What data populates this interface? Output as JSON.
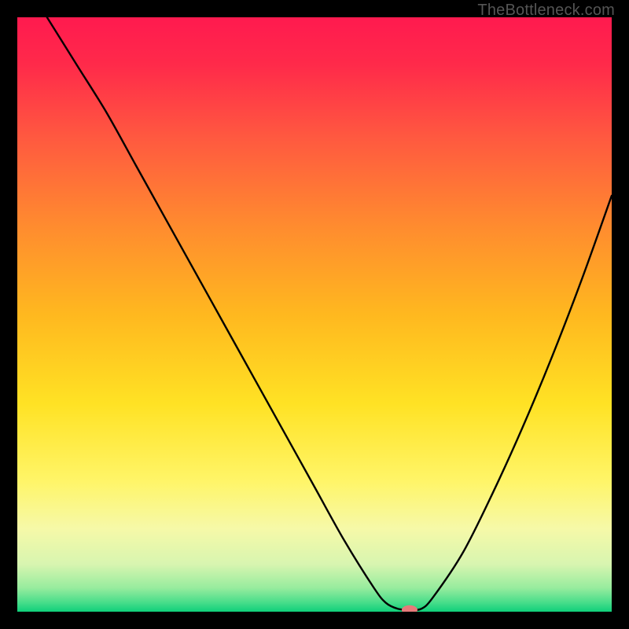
{
  "watermark": "TheBottleneck.com",
  "chart_data": {
    "type": "line",
    "title": "",
    "xlabel": "",
    "ylabel": "",
    "xlim": [
      0,
      100
    ],
    "ylim": [
      0,
      100
    ],
    "x": [
      5,
      10,
      15,
      20,
      25,
      30,
      35,
      40,
      45,
      50,
      55,
      60,
      62,
      64,
      66,
      68,
      70,
      75,
      80,
      85,
      90,
      95,
      100
    ],
    "values": [
      100,
      92,
      84,
      75,
      66,
      57,
      48,
      39,
      30,
      21,
      12,
      4,
      1.5,
      0.5,
      0.3,
      0.5,
      2.5,
      10,
      20,
      31,
      43,
      56,
      70
    ],
    "marker": {
      "x": 66,
      "y": 0.3
    },
    "gradient_stops": [
      {
        "offset": 0.0,
        "color": "#ff1a4f"
      },
      {
        "offset": 0.08,
        "color": "#ff2a4a"
      },
      {
        "offset": 0.2,
        "color": "#ff5840"
      },
      {
        "offset": 0.35,
        "color": "#ff8b2f"
      },
      {
        "offset": 0.5,
        "color": "#ffb81f"
      },
      {
        "offset": 0.65,
        "color": "#ffe224"
      },
      {
        "offset": 0.78,
        "color": "#fff568"
      },
      {
        "offset": 0.86,
        "color": "#f6f9a8"
      },
      {
        "offset": 0.92,
        "color": "#d8f5b0"
      },
      {
        "offset": 0.96,
        "color": "#97ec9e"
      },
      {
        "offset": 0.985,
        "color": "#46dd8a"
      },
      {
        "offset": 1.0,
        "color": "#0fcf7a"
      }
    ],
    "curve_color": "#000000",
    "curve_width": 2.4,
    "marker_color": "#e77a7a",
    "marker_rx": 10,
    "marker_ry": 6
  }
}
